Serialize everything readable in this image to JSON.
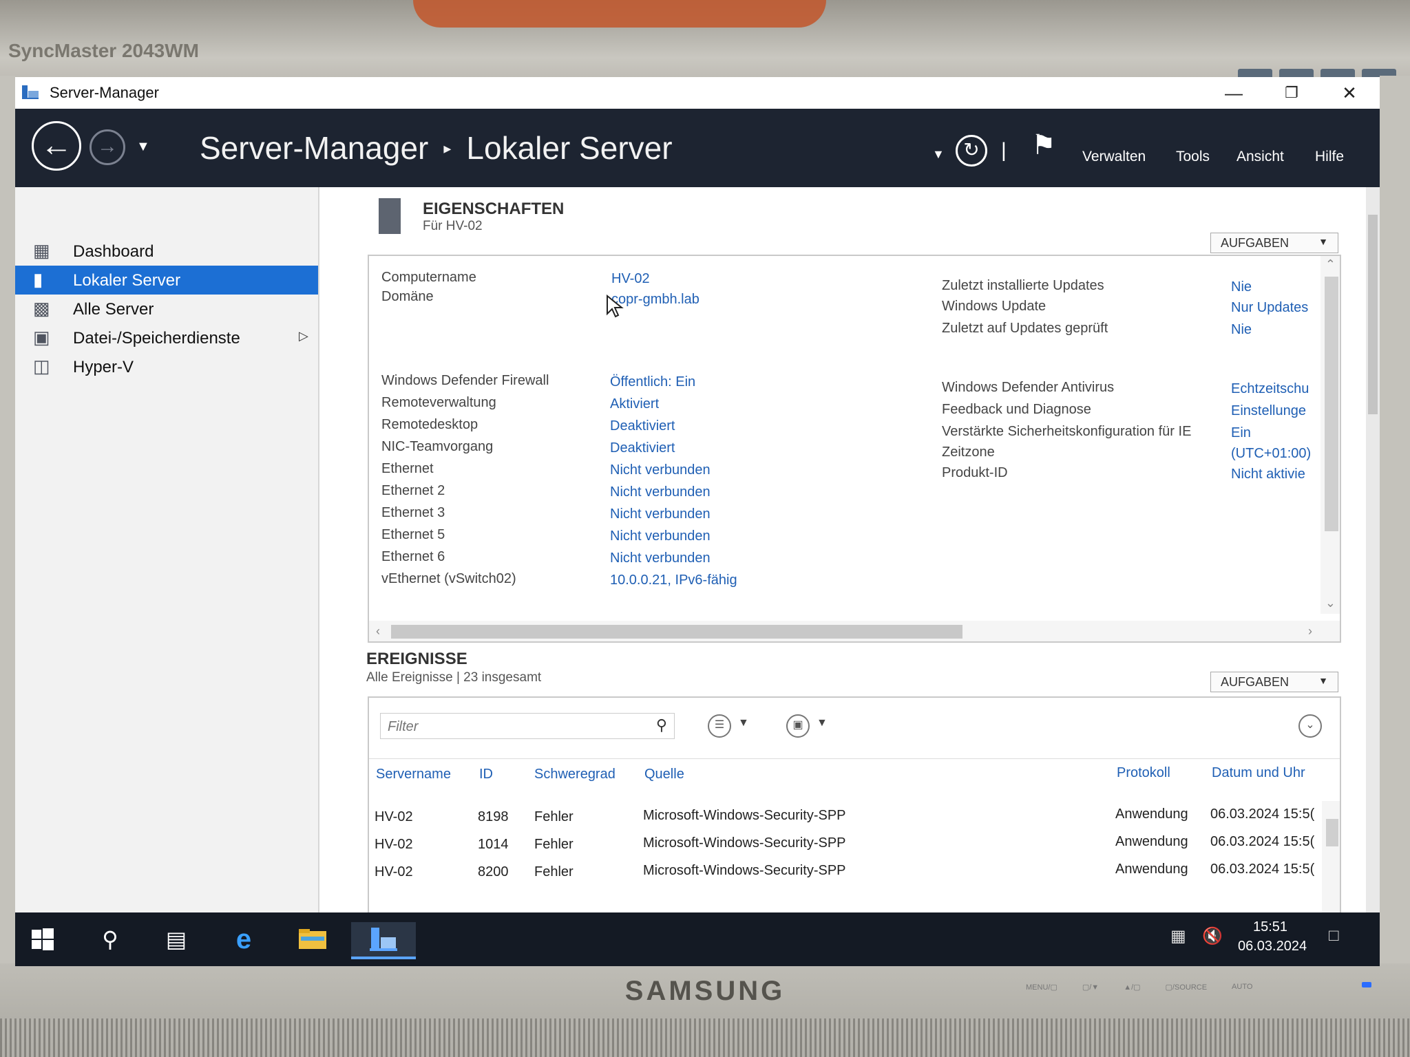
{
  "monitor": {
    "model": "SyncMaster 2043WM",
    "brand": "SAMSUNG",
    "buttons": [
      "MENU/▢",
      "▢/▼",
      "▲/▢",
      "▢/SOURCE",
      "AUTO"
    ]
  },
  "window": {
    "title": "Server-Manager",
    "controls": {
      "minimize": "—",
      "restore": "❐",
      "close": "✕"
    }
  },
  "header": {
    "breadcrumb_root": "Server-Manager",
    "breadcrumb_sep": "▸",
    "breadcrumb_current": "Lokaler Server",
    "menu": {
      "manage": "Verwalten",
      "tools": "Tools",
      "view": "Ansicht",
      "help": "Hilfe"
    }
  },
  "sidebar": {
    "items": [
      {
        "label": "Dashboard",
        "icon": "dashboard-icon"
      },
      {
        "label": "Lokaler Server",
        "icon": "server-icon",
        "active": true
      },
      {
        "label": "Alle Server",
        "icon": "servers-icon"
      },
      {
        "label": "Datei-/Speicherdienste",
        "icon": "storage-icon",
        "has_submenu": true
      },
      {
        "label": "Hyper-V",
        "icon": "hyperv-icon"
      }
    ]
  },
  "properties": {
    "title": "EIGENSCHAFTEN",
    "subtitle": "Für HV-02",
    "tasks_label": "AUFGABEN",
    "left": [
      {
        "label": "Computername",
        "value": "HV-02"
      },
      {
        "label": "Domäne",
        "value": "copr-gmbh.lab"
      },
      {
        "label": "Windows Defender Firewall",
        "value": "Öffentlich: Ein"
      },
      {
        "label": "Remoteverwaltung",
        "value": "Aktiviert"
      },
      {
        "label": "Remotedesktop",
        "value": "Deaktiviert"
      },
      {
        "label": "NIC-Teamvorgang",
        "value": "Deaktiviert"
      },
      {
        "label": "Ethernet",
        "value": "Nicht verbunden"
      },
      {
        "label": "Ethernet 2",
        "value": "Nicht verbunden"
      },
      {
        "label": "Ethernet 3",
        "value": "Nicht verbunden"
      },
      {
        "label": "Ethernet 5",
        "value": "Nicht verbunden"
      },
      {
        "label": "Ethernet 6",
        "value": "Nicht verbunden"
      },
      {
        "label": "vEthernet (vSwitch02)",
        "value": "10.0.0.21, IPv6-fähig"
      }
    ],
    "right": [
      {
        "label": "Zuletzt installierte Updates",
        "value": "Nie"
      },
      {
        "label": "Windows Update",
        "value": "Nur Updates"
      },
      {
        "label": "Zuletzt auf Updates geprüft",
        "value": "Nie"
      },
      {
        "label": "Windows Defender Antivirus",
        "value": "Echtzeitschu"
      },
      {
        "label": "Feedback und Diagnose",
        "value": "Einstellunge"
      },
      {
        "label": "Verstärkte Sicherheitskonfiguration für IE",
        "value": "Ein"
      },
      {
        "label": "Zeitzone",
        "value": "(UTC+01:00)"
      },
      {
        "label": "Produkt-ID",
        "value": "Nicht aktivie"
      }
    ]
  },
  "events": {
    "title": "EREIGNISSE",
    "subtitle": "Alle Ereignisse | 23 insgesamt",
    "tasks_label": "AUFGABEN",
    "filter_placeholder": "Filter",
    "columns": [
      "Servername",
      "ID",
      "Schweregrad",
      "Quelle",
      "Protokoll",
      "Datum und Uhr"
    ],
    "rows": [
      [
        "HV-02",
        "8198",
        "Fehler",
        "Microsoft-Windows-Security-SPP",
        "Anwendung",
        "06.03.2024 15:5("
      ],
      [
        "HV-02",
        "1014",
        "Fehler",
        "Microsoft-Windows-Security-SPP",
        "Anwendung",
        "06.03.2024 15:5("
      ],
      [
        "HV-02",
        "8200",
        "Fehler",
        "Microsoft-Windows-Security-SPP",
        "Anwendung",
        "06.03.2024 15:5("
      ]
    ]
  },
  "taskbar": {
    "time": "15:51",
    "date": "06.03.2024",
    "icons": [
      "windows-start-icon",
      "search-icon",
      "task-view-icon",
      "internet-explorer-icon",
      "file-explorer-icon",
      "server-manager-icon"
    ]
  },
  "colors": {
    "topbar": "#1d2431",
    "accent": "#1c6fd4",
    "link": "#1f5fb4",
    "taskbar": "#141a24"
  }
}
